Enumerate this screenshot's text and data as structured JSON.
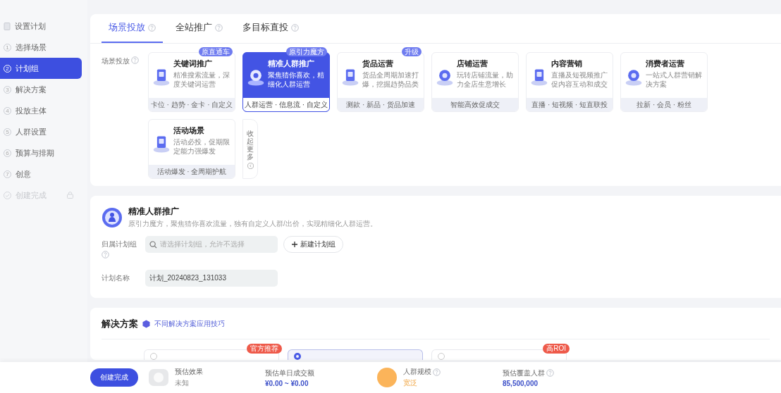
{
  "sidebar": {
    "items": [
      {
        "kind": "header",
        "label": "设置计划",
        "selected": false,
        "disabled": false
      },
      {
        "kind": "step",
        "number": "1",
        "label": "选择场景",
        "selected": false,
        "disabled": false
      },
      {
        "kind": "step",
        "number": "2",
        "label": "计划组",
        "selected": true,
        "disabled": false
      },
      {
        "kind": "step",
        "number": "3",
        "label": "解决方案",
        "selected": false,
        "disabled": false
      },
      {
        "kind": "step",
        "number": "4",
        "label": "投放主体",
        "selected": false,
        "disabled": false
      },
      {
        "kind": "step",
        "number": "5",
        "label": "人群设置",
        "selected": false,
        "disabled": false
      },
      {
        "kind": "step",
        "number": "6",
        "label": "预算与排期",
        "selected": false,
        "disabled": false
      },
      {
        "kind": "step",
        "number": "7",
        "label": "创意",
        "selected": false,
        "disabled": false
      },
      {
        "kind": "finish",
        "label": "创建完成",
        "selected": false,
        "disabled": true
      }
    ]
  },
  "tabs": [
    {
      "label": "场景投放",
      "selected": true
    },
    {
      "label": "全站推广",
      "selected": false
    },
    {
      "label": "多目标直投",
      "selected": false
    }
  ],
  "scene": {
    "label": "场景投放",
    "cards": [
      {
        "title": "关键词推广",
        "description": "精准搜索流量，深度关键词运营",
        "tags": "卡位 · 趋势 · 金卡 · 自定义",
        "badge": "原直通车",
        "selected": false
      },
      {
        "title": "精准人群推广",
        "description": "聚焦猜你喜欢，精细化人群运营",
        "tags": "人群运营 · 信息流 · 自定义",
        "badge": "原引力魔方",
        "selected": true
      },
      {
        "title": "货品运营",
        "description": "货品全周期加速打爆，挖掘趋势品类",
        "tags": "测款 · 新品 · 货品加速",
        "badge": "升级",
        "selected": false
      },
      {
        "title": "店铺运营",
        "description": "玩转店铺流量，助力全店生意增长",
        "tags": "智能高效促成交",
        "selected": false
      },
      {
        "title": "内容营销",
        "description": "直播及短视频推广促内容互动和成交",
        "tags": "直播 · 短视频 · 短直联投",
        "selected": false
      },
      {
        "title": "消费者运营",
        "description": "一站式人群营销解决方案",
        "tags": "拉新 · 会员 · 粉丝",
        "selected": false
      },
      {
        "title": "活动场景",
        "description": "活动必投，促期限定能力强爆发",
        "tags": "活动爆发 · 全周期护航",
        "selected": false
      }
    ],
    "collapse": "收起更多"
  },
  "plan": {
    "title": "精准人群推广",
    "description": "原引力魔方，聚焦猜你喜欢流量，独有自定义人群/出价，实现精细化人群运营。",
    "group_label": "归属计划组",
    "group_placeholder": "请选择计划组，允许不选择",
    "new_group": "新建计划组",
    "name_label": "计划名称",
    "name_value": "计划_20240823_131033"
  },
  "solution": {
    "title": "解决方案",
    "tip": "不同解决方案应用技巧",
    "options": [
      {
        "badge": "官方推荐",
        "selected": false
      },
      {
        "selected": true
      },
      {
        "badge": "高ROI",
        "selected": false
      }
    ]
  },
  "footer": {
    "create": "创建完成",
    "effect_label": "预估效果",
    "effect_value": "未知",
    "gmv_label": "预估单日成交额",
    "gmv_value": "¥0.00 ~ ¥0.00",
    "crowd_label": "人群规模",
    "crowd_value": "宽泛",
    "cover_label": "预估覆盖人群",
    "cover_value": "85,500,000"
  }
}
